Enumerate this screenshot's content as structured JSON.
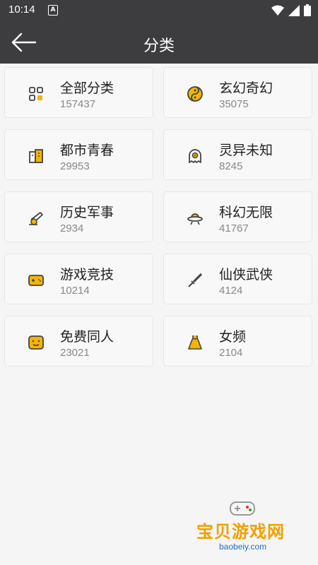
{
  "status_bar": {
    "time": "10:14",
    "notification_letter": "A"
  },
  "toolbar": {
    "title": "分类"
  },
  "categories": [
    {
      "name": "全部分类",
      "count": "157437",
      "icon": "grid-icon"
    },
    {
      "name": "玄幻奇幻",
      "count": "35075",
      "icon": "yin-yang-icon"
    },
    {
      "name": "都市青春",
      "count": "29953",
      "icon": "city-building-icon"
    },
    {
      "name": "灵异未知",
      "count": "8245",
      "icon": "ghost-icon"
    },
    {
      "name": "历史军事",
      "count": "2934",
      "icon": "cannon-icon"
    },
    {
      "name": "科幻无限",
      "count": "41767",
      "icon": "ufo-icon"
    },
    {
      "name": "游戏竞技",
      "count": "10214",
      "icon": "gamepad-icon"
    },
    {
      "name": "仙侠武侠",
      "count": "4124",
      "icon": "sword-icon"
    },
    {
      "name": "免费同人",
      "count": "23021",
      "icon": "smiley-face-icon"
    },
    {
      "name": "女频",
      "count": "2104",
      "icon": "dress-icon"
    }
  ],
  "watermark": {
    "text": "宝贝游戏网",
    "url": "baobeiy.com"
  },
  "colors": {
    "bar": "#3d3d3f",
    "accent": "#f5b400",
    "icon_stroke": "#444444"
  }
}
